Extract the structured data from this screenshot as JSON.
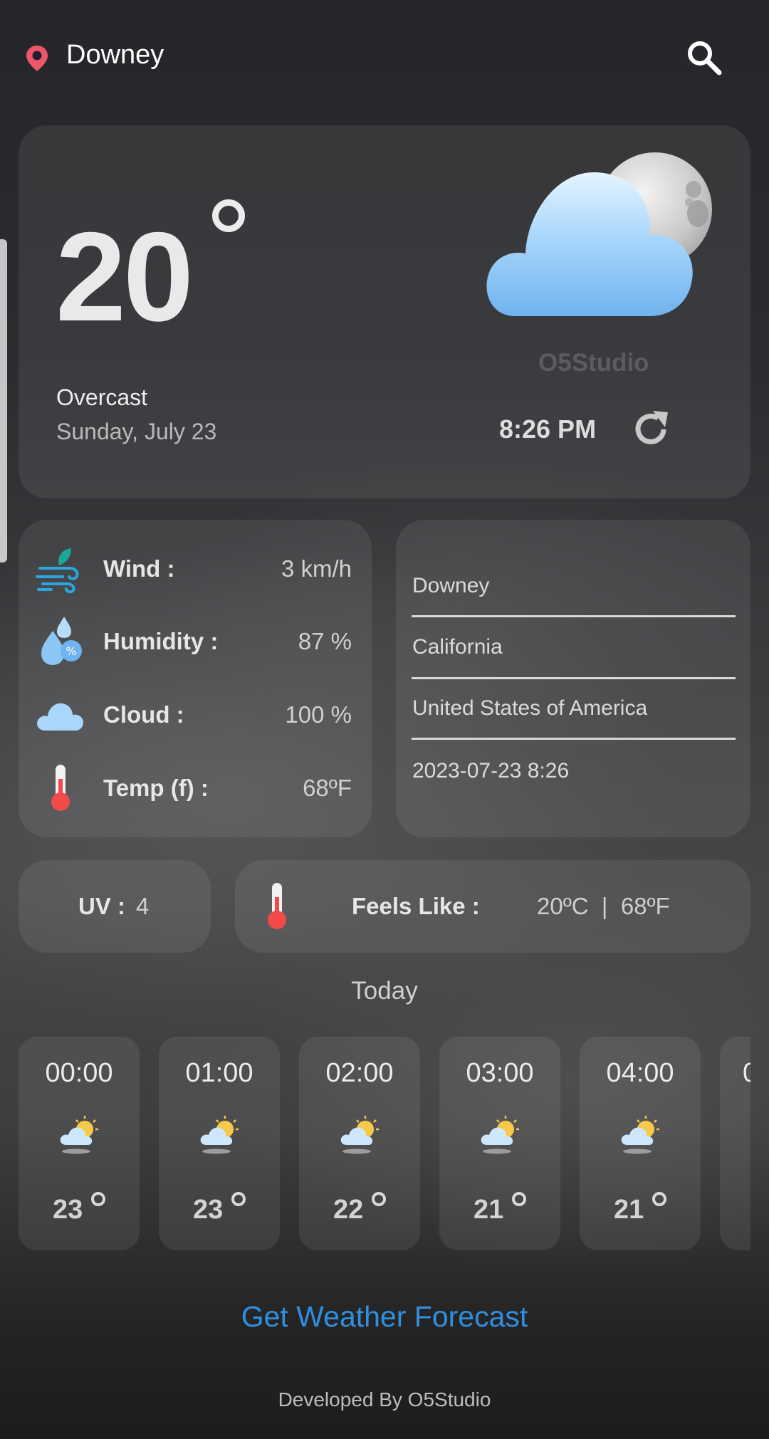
{
  "header": {
    "city": "Downey"
  },
  "current": {
    "temp": "20",
    "condition": "Overcast",
    "date": "Sunday, July 23",
    "brand_watermark": "O5Studio",
    "time": "8:26 PM"
  },
  "stats": {
    "wind_label": "Wind  :",
    "wind_value": "3 km/h",
    "humidity_label": "Humidity :",
    "humidity_value": "87 %",
    "cloud_label": "Cloud :",
    "cloud_value": "100 %",
    "tempf_label": "Temp (f) :",
    "tempf_value": "68ºF"
  },
  "location": {
    "city": "Downey",
    "region": "California",
    "country": "United States of America",
    "localtime": "2023-07-23 8:26"
  },
  "uv": {
    "label": "UV :",
    "value": "4"
  },
  "feels": {
    "label": "Feels Like :",
    "value": "20ºC  |  68ºF"
  },
  "today_label": "Today",
  "hourly": [
    {
      "time": "00:00",
      "temp": "23"
    },
    {
      "time": "01:00",
      "temp": "23"
    },
    {
      "time": "02:00",
      "temp": "22"
    },
    {
      "time": "03:00",
      "temp": "21"
    },
    {
      "time": "04:00",
      "temp": "21"
    },
    {
      "time": "0"
    }
  ],
  "forecast_link": "Get Weather Forecast",
  "footer": "Developed By O5Studio",
  "colors": {
    "accent": "#2f8fe0",
    "pin": "#f0566a",
    "thermometer": "#f24a4a"
  }
}
